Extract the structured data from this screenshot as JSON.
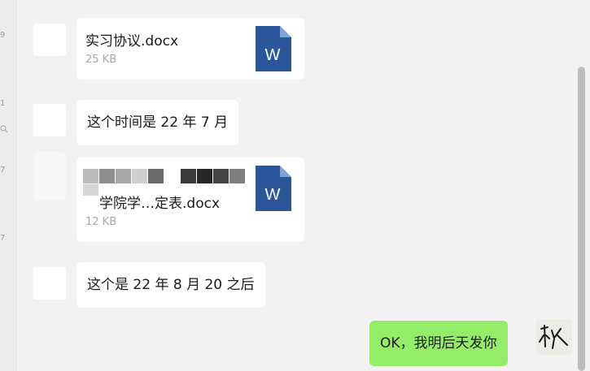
{
  "gutter": {
    "marks": [
      "9",
      "1",
      "7",
      "7"
    ]
  },
  "messages": [
    {
      "file_name": "实习协议.docx",
      "file_size": "25 KB",
      "file_icon_label": "W"
    },
    {
      "text": "这个时间是 22 年 7 月"
    },
    {
      "file_name": "学院学…定表.docx",
      "file_size": "12 KB",
      "file_icon_label": "W"
    },
    {
      "text": "这个是 22 年 8 月 20 之后"
    }
  ],
  "my_message": {
    "text": "OK，我明后天发你"
  },
  "colors": {
    "word_blue": "#2b579a",
    "my_bubble": "#95ec69",
    "background": "#f2f2f2"
  }
}
